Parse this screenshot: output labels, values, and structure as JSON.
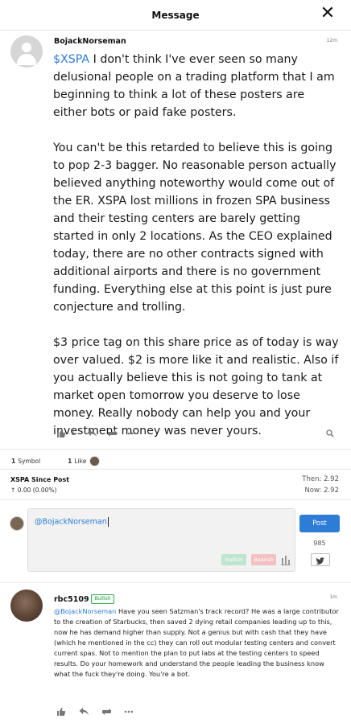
{
  "header": {
    "title": "Message",
    "close_icon": "close-icon"
  },
  "post": {
    "username": "BojackNorseman",
    "time": "12m",
    "cashtag": "$XSPA",
    "paragraphs": [
      " I don't think I've ever seen so many delusional people on a trading platform that I am beginning to think a lot of these posters are either bots or paid fake posters.",
      "You can't be this retarded to believe this is going to pop 2-3 bagger. No reasonable person actually believed anything noteworthy would come out of the ER. XSPA lost millions in frozen SPA business and their testing centers are barely getting started in only 2 locations. As the CEO explained today, there are no other contracts signed with additional airports and there is no government funding. Everything else at this point is just pure conjecture and trolling.",
      "$3 price tag on this share price as of today is way over valued. $2 is more like it and realistic. Also if you actually believe this is not going to tank at market open tomorrow you deserve to lose money. Really nobody can help you and your investment money was never yours."
    ],
    "like_count": "1"
  },
  "stats": {
    "symbol_count": "1",
    "symbol_label": "Symbol",
    "like_count": "1",
    "like_label": "Like"
  },
  "since_post": {
    "title": "XSPA Since Post",
    "change": "↑ 0.00 (0.00%)",
    "then_label": "Then:",
    "then_value": "2.92",
    "now_label": "Now:",
    "now_value": "2.92"
  },
  "compose": {
    "text": "@BojackNorseman",
    "bullish_label": "Bullish",
    "bearish_label": "Bearish",
    "post_label": "Post",
    "char_count": "985"
  },
  "reply": {
    "username": "rbc5109",
    "badge": "Bullish",
    "time": "1m",
    "mention": "@BojackNorseman",
    "text": " Have you seen Satzman's track record? He was a large contributor to the creation of Starbucks, then saved 2 dying retail companies leading up to this, now he has demand higher than supply. Not a genius but with cash that they have (which he mentioned in the cc) they can roll out modular testing centers and convert current spas. Not to mention the plan to put labs at the testing centers to speed results. Do your homework and understand the people leading the business know what the fuck they're doing. You're a bot."
  },
  "colors": {
    "accent": "#2d7cd6",
    "bullish": "#3da85f",
    "bearish": "#e57373"
  }
}
